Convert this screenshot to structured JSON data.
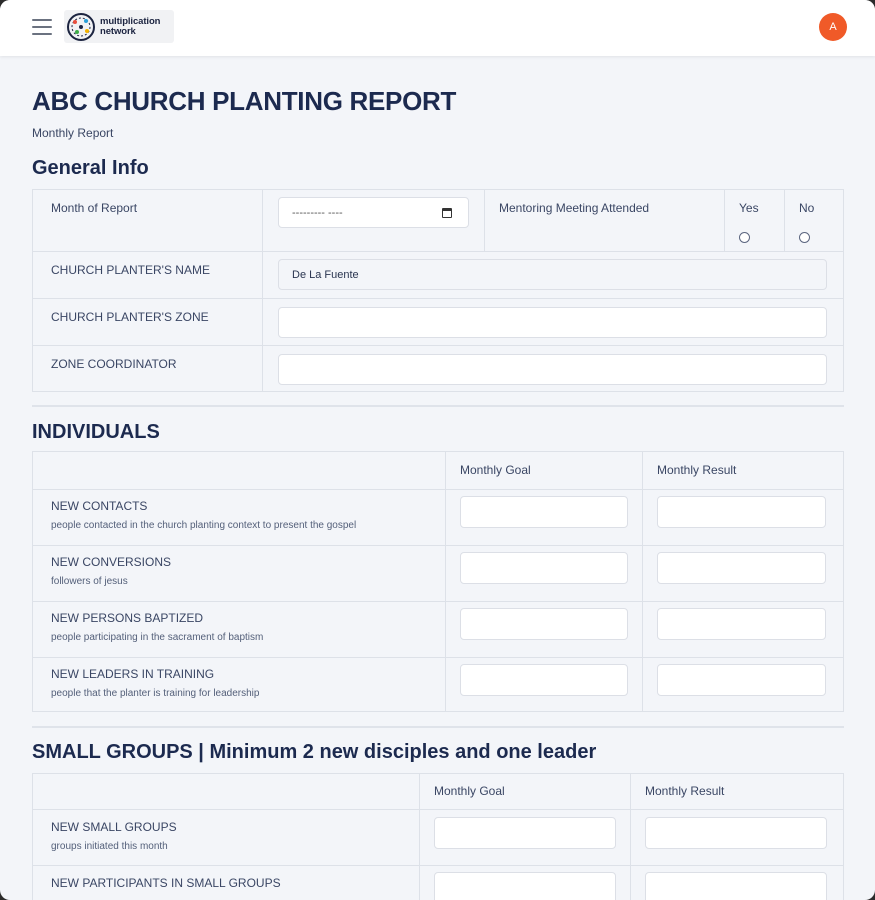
{
  "header": {
    "logo_line1": "multiplication",
    "logo_line2": "network",
    "avatar_initial": "A"
  },
  "page": {
    "title": "ABC CHURCH PLANTING REPORT",
    "subtitle": "Monthly Report"
  },
  "general": {
    "heading": "General Info",
    "month_label": "Month of Report",
    "month_placeholder": "--------- ----",
    "mentoring_label": "Mentoring Meeting Attended",
    "yes_label": "Yes",
    "no_label": "No",
    "planter_name_label": "CHURCH PLANTER'S NAME",
    "planter_name_value": "De La Fuente",
    "planter_zone_label": "CHURCH PLANTER'S ZONE",
    "planter_zone_value": "",
    "zone_coordinator_label": "ZONE COORDINATOR",
    "zone_coordinator_value": ""
  },
  "individuals": {
    "heading": "INDIVIDUALS",
    "col_goal": "Monthly Goal",
    "col_result": "Monthly Result",
    "rows": [
      {
        "label": "NEW CONTACTS",
        "desc": "people contacted in the church planting context to present the gospel"
      },
      {
        "label": "NEW CONVERSIONS",
        "desc": "followers of jesus"
      },
      {
        "label": "NEW PERSONS BAPTIZED",
        "desc": "people participating in the sacrament of baptism"
      },
      {
        "label": "NEW LEADERS IN TRAINING",
        "desc": "people that the planter is training for leadership"
      }
    ]
  },
  "small_groups": {
    "heading": "SMALL GROUPS | Minimum 2 new disciples and one leader",
    "col_goal": "Monthly Goal",
    "col_result": "Monthly Result",
    "rows": [
      {
        "label": "NEW SMALL GROUPS",
        "desc": "groups initiated this month"
      },
      {
        "label": "NEW PARTICIPANTS IN SMALL GROUPS",
        "desc": ""
      }
    ]
  }
}
